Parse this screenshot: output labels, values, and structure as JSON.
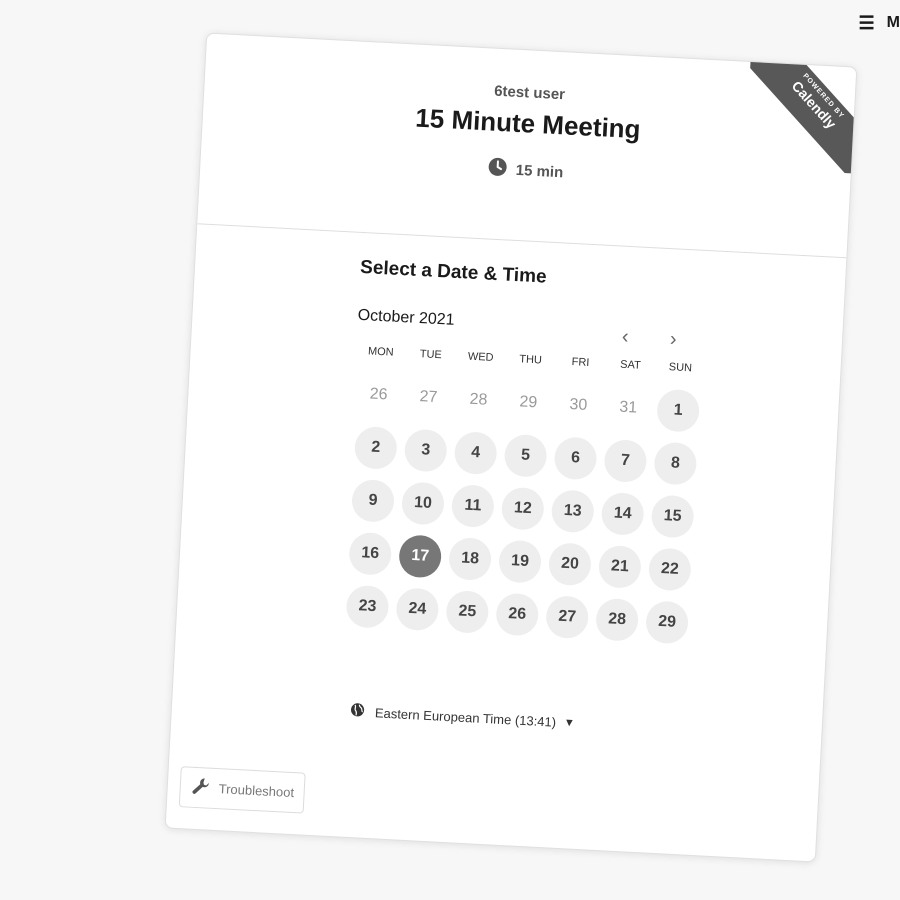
{
  "top_menu": {
    "label": "M"
  },
  "header": {
    "owner_name": "6test user",
    "event_title": "15 Minute Meeting",
    "duration": "15 min"
  },
  "ribbon": {
    "small_text": "POWERED BY",
    "brand": "Calendly"
  },
  "scheduler": {
    "section_title": "Select a Date & Time",
    "month_label": "October 2021",
    "weekdays": [
      "MON",
      "TUE",
      "WED",
      "THU",
      "FRI",
      "SAT",
      "SUN"
    ],
    "days": [
      {
        "label": "26",
        "state": "out"
      },
      {
        "label": "27",
        "state": "out"
      },
      {
        "label": "28",
        "state": "out"
      },
      {
        "label": "29",
        "state": "out"
      },
      {
        "label": "30",
        "state": "out"
      },
      {
        "label": "31",
        "state": "out"
      },
      {
        "label": "1",
        "state": "avail"
      },
      {
        "label": "2",
        "state": "avail"
      },
      {
        "label": "3",
        "state": "avail"
      },
      {
        "label": "4",
        "state": "avail"
      },
      {
        "label": "5",
        "state": "avail"
      },
      {
        "label": "6",
        "state": "avail"
      },
      {
        "label": "7",
        "state": "avail"
      },
      {
        "label": "8",
        "state": "avail"
      },
      {
        "label": "9",
        "state": "avail"
      },
      {
        "label": "10",
        "state": "avail"
      },
      {
        "label": "11",
        "state": "avail"
      },
      {
        "label": "12",
        "state": "avail"
      },
      {
        "label": "13",
        "state": "avail"
      },
      {
        "label": "14",
        "state": "avail"
      },
      {
        "label": "15",
        "state": "avail"
      },
      {
        "label": "16",
        "state": "avail"
      },
      {
        "label": "17",
        "state": "selected"
      },
      {
        "label": "18",
        "state": "avail"
      },
      {
        "label": "19",
        "state": "avail"
      },
      {
        "label": "20",
        "state": "avail"
      },
      {
        "label": "21",
        "state": "avail"
      },
      {
        "label": "22",
        "state": "avail"
      },
      {
        "label": "23",
        "state": "avail"
      },
      {
        "label": "24",
        "state": "avail"
      },
      {
        "label": "25",
        "state": "avail"
      },
      {
        "label": "26",
        "state": "avail"
      },
      {
        "label": "27",
        "state": "avail"
      },
      {
        "label": "28",
        "state": "avail"
      },
      {
        "label": "29",
        "state": "avail"
      }
    ],
    "timezone": "Eastern European Time (13:41)"
  },
  "troubleshoot": {
    "label": "Troubleshoot"
  },
  "icons": {
    "menu": "hamburger-icon",
    "clock": "clock-icon",
    "prev": "chevron-left-icon",
    "next": "chevron-right-icon",
    "globe": "globe-icon",
    "caret": "caret-down-icon",
    "wrench": "wrench-icon"
  },
  "colors": {
    "selected_day": "#777777",
    "available_day": "#eeeeee",
    "ribbon": "#585858"
  }
}
